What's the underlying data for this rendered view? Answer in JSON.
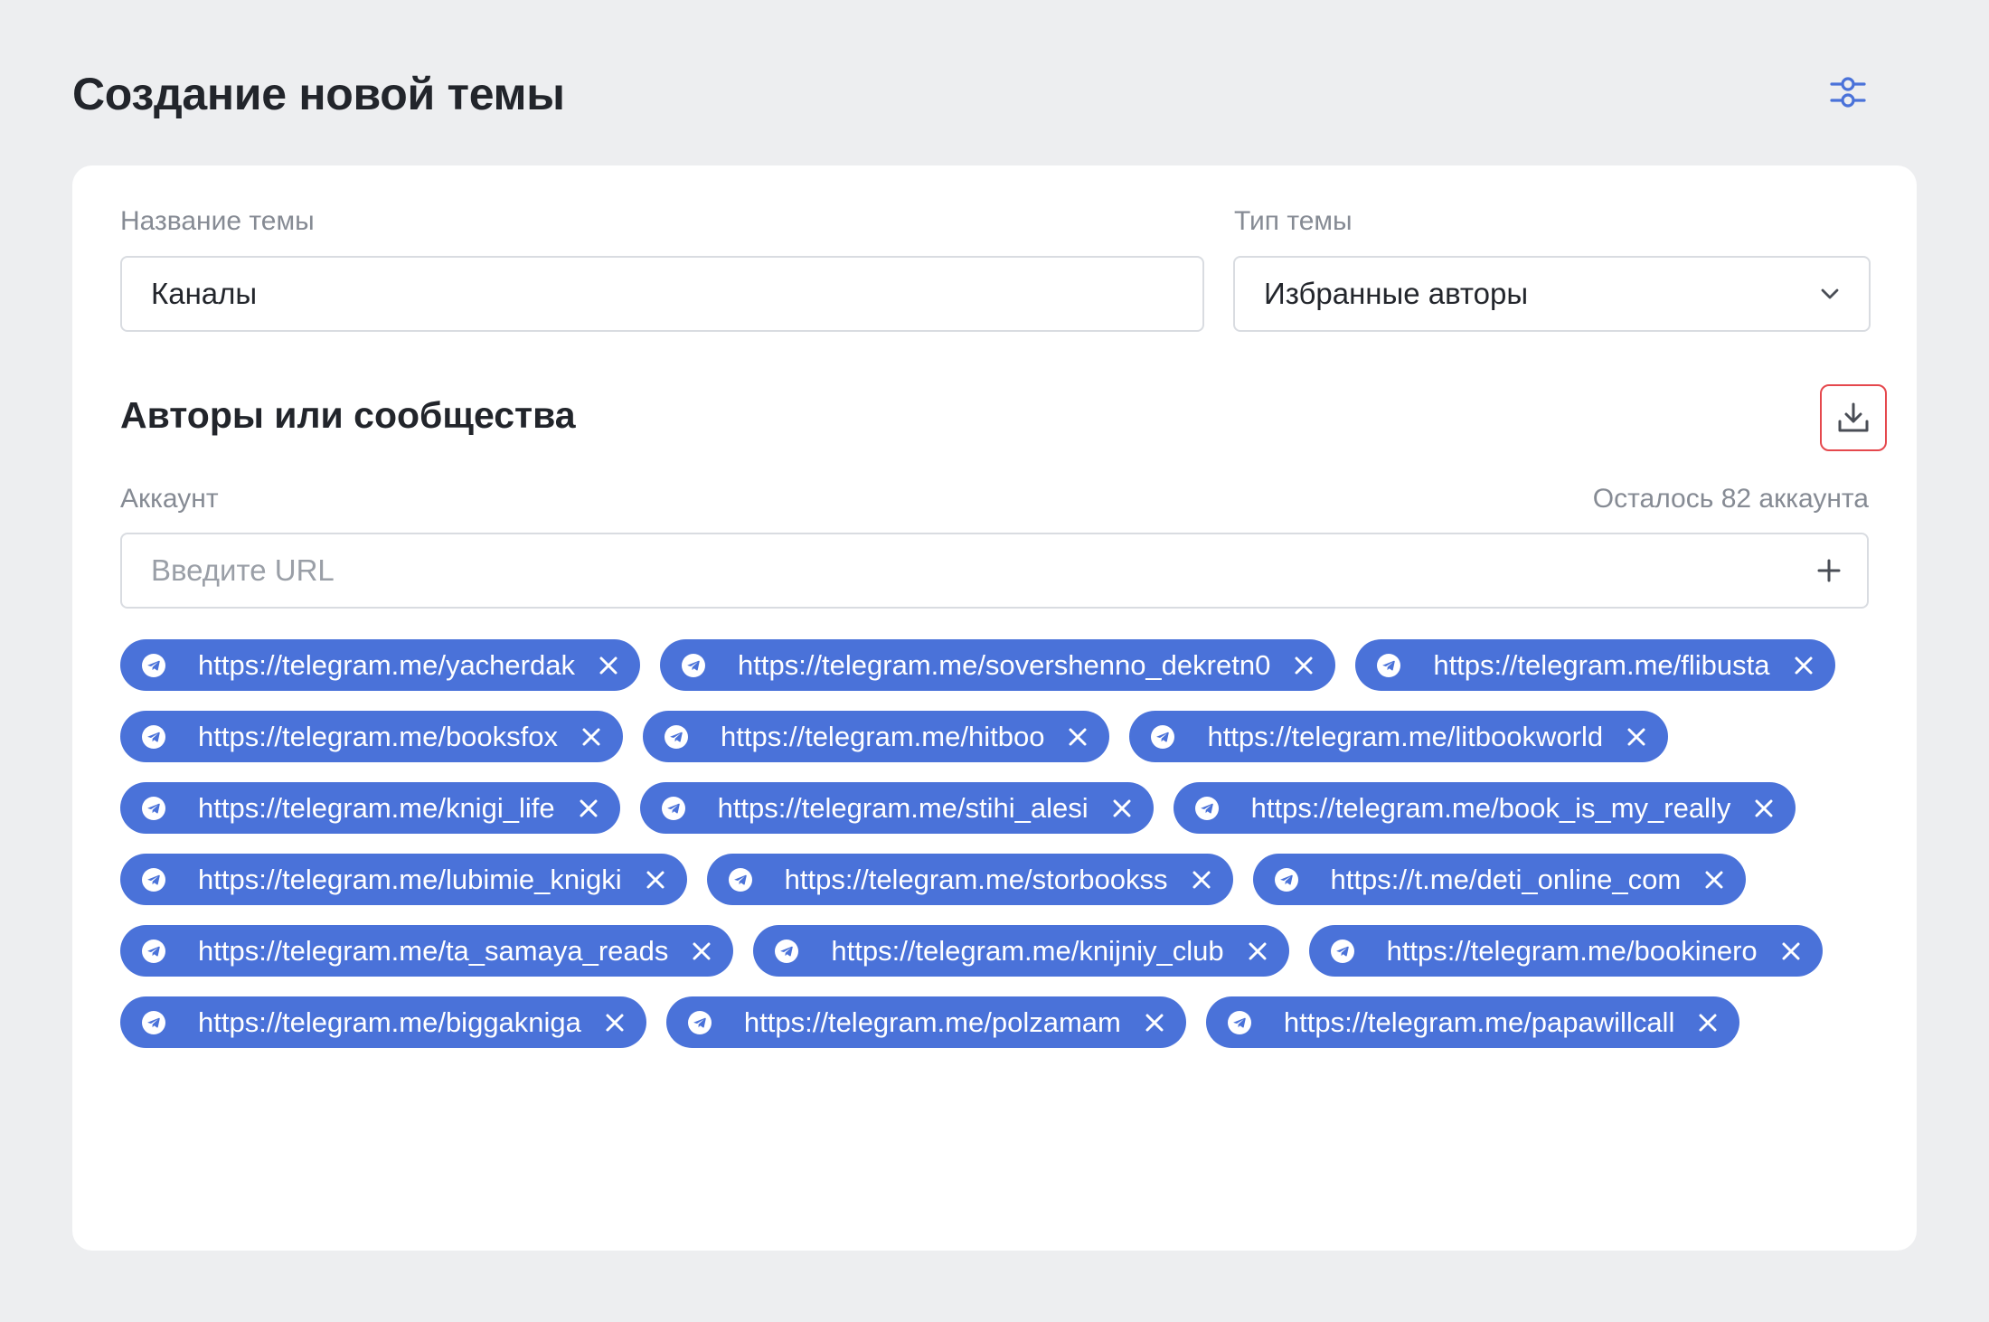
{
  "page": {
    "title": "Создание новой темы",
    "settings_icon": "sliders-icon"
  },
  "form": {
    "name_label": "Название темы",
    "name_value": "Каналы",
    "type_label": "Тип темы",
    "type_value": "Избранные авторы",
    "type_icon": "chevron-down-icon"
  },
  "authors": {
    "section_title": "Авторы или сообщества",
    "import_icon": "download-icon",
    "account_label": "Аккаунт",
    "remaining_text": "Осталось 82 аккаунта",
    "url_placeholder": "Введите URL",
    "add_icon": "plus-icon",
    "tag_icon": "telegram-icon",
    "remove_icon": "close-icon",
    "tags": [
      "https://telegram.me/yacherdak",
      "https://telegram.me/sovershenno_dekretn0",
      "https://telegram.me/flibusta",
      "https://telegram.me/booksfox",
      "https://telegram.me/hitboo",
      "https://telegram.me/litbookworld",
      "https://telegram.me/knigi_life",
      "https://telegram.me/stihi_alesi",
      "https://telegram.me/book_is_my_really",
      "https://telegram.me/lubimie_knigki",
      "https://telegram.me/storbookss",
      "https://t.me/deti_online_com",
      "https://telegram.me/ta_samaya_reads",
      "https://telegram.me/knijniy_club",
      "https://telegram.me/bookinero",
      "https://telegram.me/biggakniga",
      "https://telegram.me/polzamam",
      "https://telegram.me/papawillcall"
    ]
  },
  "colors": {
    "background": "#EDEEF0",
    "card": "#FFFFFF",
    "tag": "#4A72D9",
    "import_border": "#E5484D",
    "muted_text": "#868B94"
  }
}
